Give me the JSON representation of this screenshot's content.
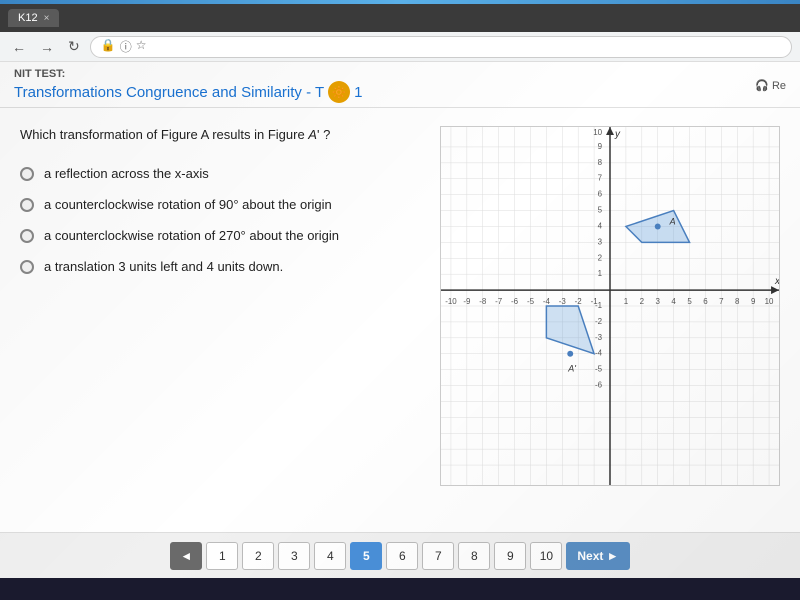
{
  "browser": {
    "tab_label": "K12",
    "tab_close": "×",
    "nav_back": "←",
    "nav_forward": "→",
    "nav_reload": "×",
    "address_text": "",
    "address_icon1": "🔒",
    "address_icon2": "⓪",
    "address_icon3": "📄"
  },
  "header": {
    "unit_label": "NIT TEST:",
    "title_prefix": "ransformations Congruence and Similarity - T",
    "test_number": "1",
    "re_button": "Re"
  },
  "question": {
    "text": "Which transformation of Figure A results in Figure A'?",
    "figure_a_label": "A",
    "figure_a_prime_label": "A'",
    "options": [
      {
        "id": "a",
        "text": "a reflection across the x-axis"
      },
      {
        "id": "b",
        "text": "a counterclockwise rotation of 90° about the origin"
      },
      {
        "id": "c",
        "text": "a counterclockwise rotation of 270° about the origin"
      },
      {
        "id": "d",
        "text": "a translation 3 units left and 4 units down."
      }
    ]
  },
  "graph": {
    "x_min": -10,
    "x_max": 10,
    "y_min": -6,
    "y_max": 10,
    "axis_labels": {
      "x": "x",
      "y": "y"
    },
    "figure_a_vertices": [
      [
        1,
        4
      ],
      [
        4,
        5
      ],
      [
        5,
        3
      ],
      [
        2,
        3
      ]
    ],
    "figure_a_prime_vertices": [
      [
        -2,
        -1
      ],
      [
        -1,
        -4
      ],
      [
        -4,
        -3
      ],
      [
        -4,
        -1
      ]
    ]
  },
  "pagination": {
    "prev_arrow": "◄",
    "next_arrow": "►",
    "pages": [
      "1",
      "2",
      "3",
      "4",
      "5",
      "6",
      "7",
      "8",
      "9",
      "10"
    ],
    "active_page": "5",
    "next_label": "Next ►"
  }
}
